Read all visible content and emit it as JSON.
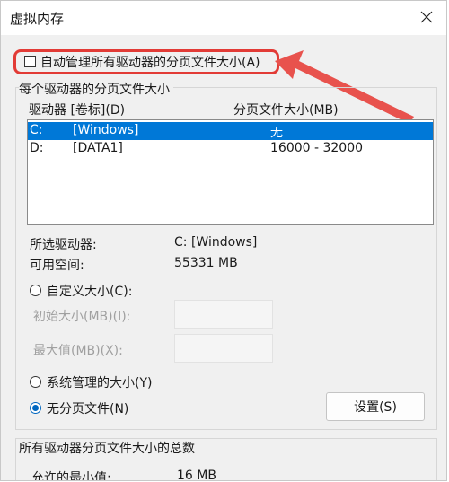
{
  "window": {
    "title": "虚拟内存"
  },
  "auto_manage": {
    "label": "自动管理所有驱动器的分页文件大小(A)",
    "checked": false
  },
  "paging_group": {
    "title": "每个驱动器的分页文件大小",
    "columns": {
      "drive": "驱动器 [卷标](D)",
      "size": "分页文件大小(MB)"
    },
    "rows": [
      {
        "drive": "C:",
        "label": "[Windows]",
        "size": "无",
        "selected": true
      },
      {
        "drive": "D:",
        "label": "[DATA1]",
        "size": "16000 - 32000",
        "selected": false
      }
    ],
    "selected_drive_label": "所选驱动器:",
    "selected_drive_value": "C:  [Windows]",
    "free_space_label": "可用空间:",
    "free_space_value": "55331 MB",
    "custom_size": {
      "label": "自定义大小(C):",
      "checked": false
    },
    "initial_size_label": "初始大小(MB)(I):",
    "max_size_label": "最大值(MB)(X):",
    "system_managed": {
      "label": "系统管理的大小(Y)",
      "checked": false
    },
    "no_paging": {
      "label": "无分页文件(N)",
      "checked": true
    },
    "set_button": "设置(S)"
  },
  "total_group": {
    "title": "所有驱动器分页文件大小的总数",
    "min_allowed_label": "允许的最小值:",
    "min_allowed_value": "16 MB"
  },
  "colors": {
    "accent": "#0078d7",
    "highlight": "#e23b36"
  }
}
